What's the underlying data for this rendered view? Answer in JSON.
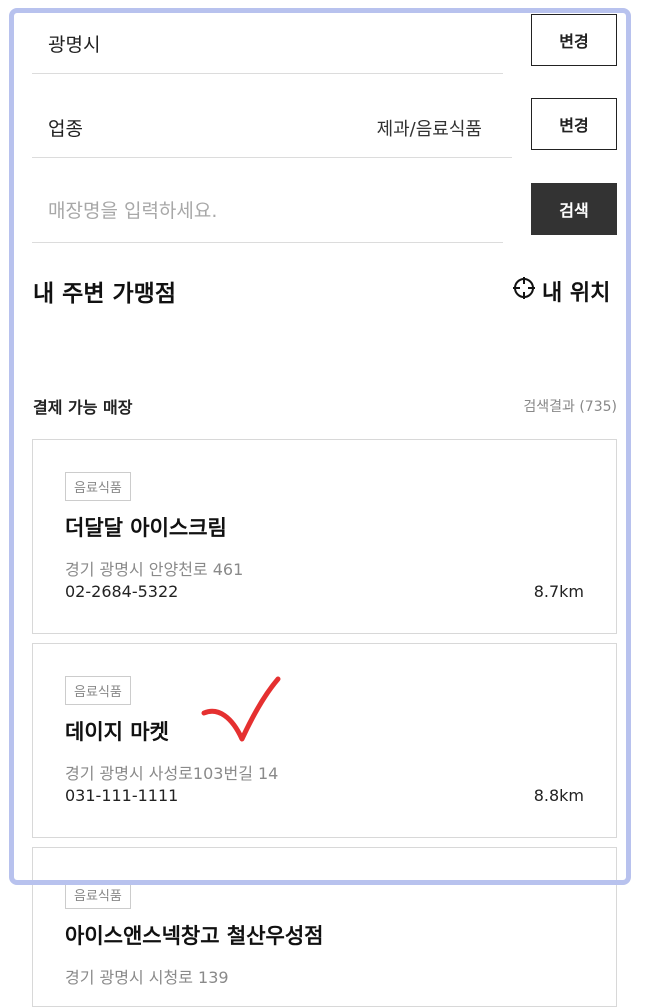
{
  "filters": {
    "region": {
      "label": "광명시",
      "button": "변경"
    },
    "category": {
      "label": "업종",
      "value": "제과/음료식품",
      "button": "변경"
    },
    "search": {
      "placeholder": "매장명을 입력하세요.",
      "value": "",
      "button": "검색"
    }
  },
  "nearby": {
    "title": "내 주변 가맹점",
    "my_location": "내 위치"
  },
  "payable": {
    "title": "결제 가능 매장",
    "result_count": "검색결과 (735)"
  },
  "stores": [
    {
      "category": "음료식품",
      "name": "더달달 아이스크림",
      "address": "경기 광명시 안양천로 461",
      "phone": "02-2684-5322",
      "distance": "8.7km"
    },
    {
      "category": "음료식품",
      "name": "데이지 마켓",
      "address": "경기 광명시 사성로103번길 14",
      "phone": "031-111-1111",
      "distance": "8.8km"
    },
    {
      "category": "음료식품",
      "name": "아이스앤스넥창고 철산우성점",
      "address": "경기 광명시 시청로 139",
      "phone": "",
      "distance": ""
    }
  ],
  "colors": {
    "frame": "#b8c2ee",
    "annotation": "#e53030",
    "dark_button": "#333333"
  }
}
